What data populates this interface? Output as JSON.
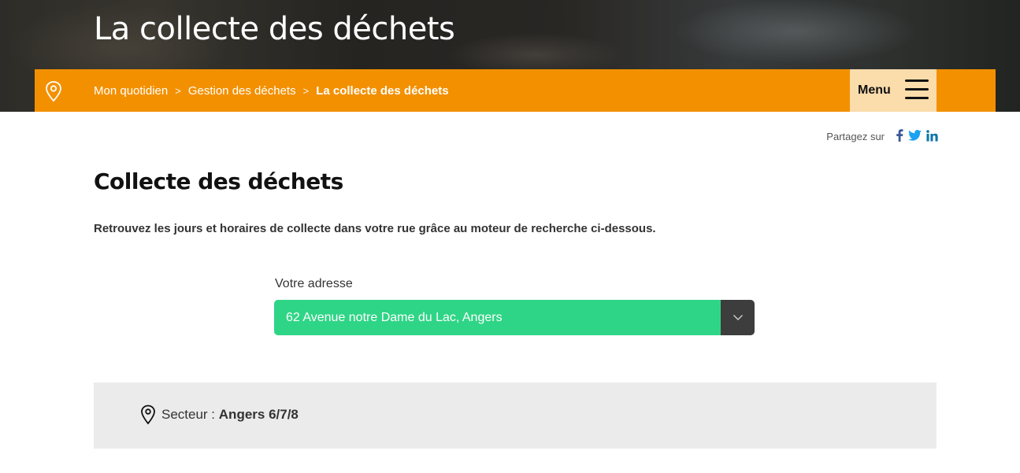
{
  "hero": {
    "title": "La collecte des déchets"
  },
  "breadcrumb": {
    "items": [
      "Mon quotidien",
      "Gestion des déchets",
      "La collecte des déchets"
    ],
    "separator": ">"
  },
  "menu": {
    "label": "Menu"
  },
  "share": {
    "label": "Partagez sur",
    "networks": [
      "facebook-icon",
      "twitter-icon",
      "linkedin-icon"
    ]
  },
  "main": {
    "title": "Collecte des déchets",
    "intro": "Retrouvez les jours et horaires de collecte dans votre rue grâce au moteur de recherche ci-dessous."
  },
  "address": {
    "label": "Votre adresse",
    "value": "62 Avenue notre Dame du Lac, Angers"
  },
  "sector": {
    "label": "Secteur :",
    "value": "Angers 6/7/8"
  },
  "colors": {
    "accent_orange": "#f39000",
    "menu_bg": "#fbdcab",
    "select_green": "#2fd586",
    "select_toggle": "#3d3d3d",
    "sector_bg": "#ebebeb",
    "facebook": "#3b5998",
    "twitter": "#1da1f2",
    "linkedin": "#0e76a8"
  }
}
